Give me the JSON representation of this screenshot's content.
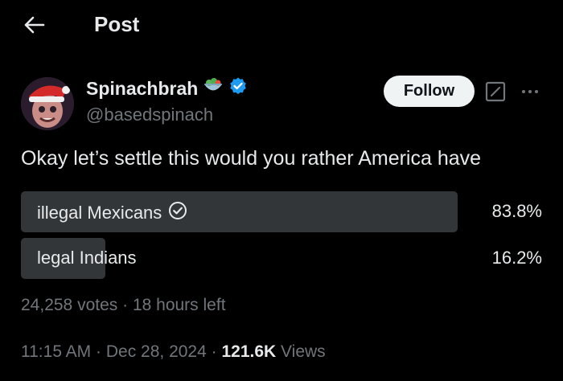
{
  "header": {
    "title": "Post",
    "back_icon": "back-arrow-icon"
  },
  "author": {
    "name": "Spinachbrah",
    "emoji_icon": "salad-bowl-icon",
    "verified_icon": "verified-badge-icon",
    "handle": "@basedspinach",
    "verified_color": "#1d9bf0"
  },
  "actions": {
    "follow_label": "Follow",
    "grok_icon": "grok-icon",
    "more_icon": "more-icon"
  },
  "post": {
    "text": "Okay let’s settle this would you rather America have"
  },
  "poll": {
    "options": [
      {
        "label": "illegal Mexicans",
        "percent": "83.8%",
        "fraction": 0.838,
        "selected": true
      },
      {
        "label": "legal Indians",
        "percent": "16.2%",
        "fraction": 0.162,
        "selected": false
      }
    ],
    "votes": "24,258 votes",
    "separator": "·",
    "time_left": "18 hours left"
  },
  "meta": {
    "time": "11:15 AM",
    "date": "Dec 28, 2024",
    "views_count": "121.6K",
    "views_label": "Views",
    "separator": "·"
  }
}
